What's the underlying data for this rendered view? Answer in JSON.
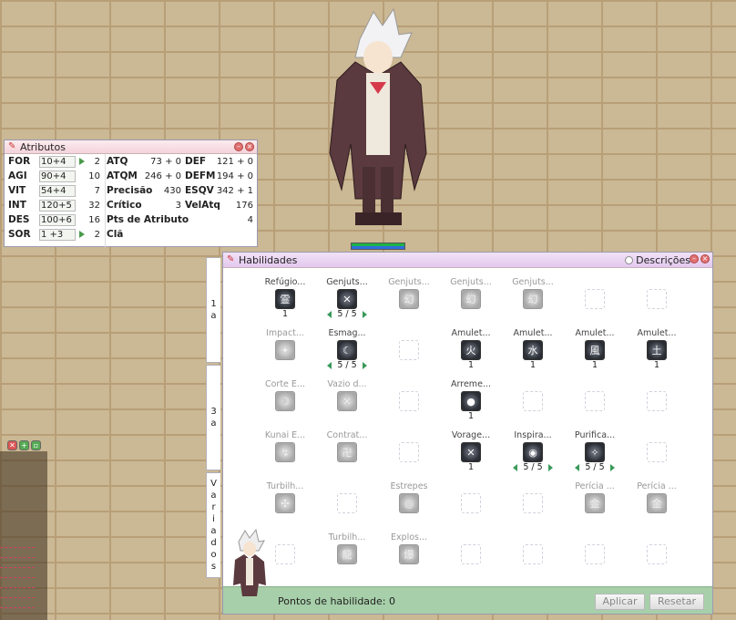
{
  "attributes_window": {
    "title": "Atributos",
    "stats": [
      {
        "name": "FOR",
        "value": "10+4",
        "cost": "2",
        "arrow": true
      },
      {
        "name": "AGI",
        "value": "90+4",
        "cost": "10",
        "arrow": false
      },
      {
        "name": "VIT",
        "value": "54+4",
        "cost": "7",
        "arrow": false
      },
      {
        "name": "INT",
        "value": "120+5",
        "cost": "32",
        "arrow": false
      },
      {
        "name": "DES",
        "value": "100+6",
        "cost": "16",
        "arrow": false
      },
      {
        "name": "SOR",
        "value": "1 +3",
        "cost": "2",
        "arrow": true
      }
    ],
    "info": {
      "atq": {
        "label": "ATQ",
        "value": "73 + 0"
      },
      "def": {
        "label": "DEF",
        "value": "121 + 0"
      },
      "atqm": {
        "label": "ATQM",
        "value": "246 + 0"
      },
      "defm": {
        "label": "DEFM",
        "value": "194 + 0"
      },
      "precisao": {
        "label": "Precisão",
        "value": "430"
      },
      "esqv": {
        "label": "ESQV",
        "value": "342 + 1"
      },
      "critico": {
        "label": "Crítico",
        "value": "3"
      },
      "velatq": {
        "label": "VelAtq",
        "value": "176"
      },
      "pts": {
        "label": "Pts de Atributo",
        "value": "4"
      },
      "cla": {
        "label": "Clã",
        "value": ""
      }
    }
  },
  "skills_window": {
    "title": "Habilidades",
    "descriptions_label": "Descrições",
    "tabs": [
      {
        "label": "1 a"
      },
      {
        "label": "3 a"
      },
      {
        "label": "V a r i a d o s"
      }
    ],
    "skills": [
      {
        "name": "Refúgio...",
        "level": "1",
        "enabled": true,
        "glyph": "霊"
      },
      {
        "name": "Genjuts...",
        "level": "5 / 5",
        "enabled": true,
        "glyph": "✕",
        "arrows": true
      },
      {
        "name": "Genjuts...",
        "level": "",
        "enabled": false,
        "glyph": "幻"
      },
      {
        "name": "Genjuts...",
        "level": "",
        "enabled": false,
        "glyph": "幻"
      },
      {
        "name": "Genjuts...",
        "level": "",
        "enabled": false,
        "glyph": "幻"
      },
      {
        "name": "Impact...",
        "level": "",
        "enabled": false,
        "glyph": "✦"
      },
      {
        "name": "Esmag...",
        "level": "5 / 5",
        "enabled": true,
        "glyph": "☾",
        "arrows": true
      },
      {
        "name": "Amulet...",
        "level": "1",
        "enabled": true,
        "glyph": "火"
      },
      {
        "name": "Amulet...",
        "level": "1",
        "enabled": true,
        "glyph": "水"
      },
      {
        "name": "Amulet...",
        "level": "1",
        "enabled": true,
        "glyph": "風"
      },
      {
        "name": "Amulet...",
        "level": "1",
        "enabled": true,
        "glyph": "土"
      },
      {
        "name": "Corte E...",
        "level": "",
        "enabled": false,
        "glyph": "☽"
      },
      {
        "name": "Vazio d...",
        "level": "",
        "enabled": false,
        "glyph": "✕"
      },
      {
        "name": "Arreme...",
        "level": "1",
        "enabled": true,
        "glyph": "●"
      },
      {
        "name": "Kunai E...",
        "level": "",
        "enabled": false,
        "glyph": "↯"
      },
      {
        "name": "Contrat...",
        "level": "",
        "enabled": false,
        "glyph": "卍"
      },
      {
        "name": "Vorage...",
        "level": "1",
        "enabled": true,
        "glyph": "✕"
      },
      {
        "name": "Inspira...",
        "level": "5 / 5",
        "enabled": true,
        "glyph": "◉",
        "arrows": true
      },
      {
        "name": "Purifica...",
        "level": "5 / 5",
        "enabled": true,
        "glyph": "✧",
        "arrows": true
      },
      {
        "name": "Turbilh...",
        "level": "",
        "enabled": false,
        "glyph": "✣"
      },
      {
        "name": "Estrepes",
        "level": "",
        "enabled": false,
        "glyph": "◎"
      },
      {
        "name": "Perícia ...",
        "level": "",
        "enabled": false,
        "glyph": "金"
      },
      {
        "name": "Perícia ...",
        "level": "",
        "enabled": false,
        "glyph": "金"
      },
      {
        "name": "Turbilh...",
        "level": "",
        "enabled": false,
        "glyph": "龍"
      },
      {
        "name": "Explos...",
        "level": "",
        "enabled": false,
        "glyph": "爆"
      }
    ],
    "points_label": "Pontos de habilidade: 0",
    "apply_label": "Aplicar",
    "reset_label": "Resetar"
  },
  "colors": {
    "title_attr": "#f4d3da",
    "title_skill": "#e3c8ef",
    "footer": "#a7cfa9",
    "stat_arrow": "#4a9a4a"
  }
}
